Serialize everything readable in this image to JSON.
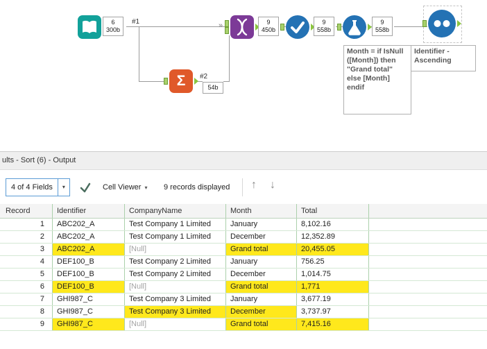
{
  "canvas": {
    "icons": {
      "sigma": "Σ",
      "conn_arrow": "»"
    },
    "labels": {
      "conn1": "#1",
      "conn2": "#2"
    },
    "counts": {
      "input": {
        "records": "6",
        "size": "300b"
      },
      "summarize": {
        "size": "54b"
      },
      "join": {
        "records": "9",
        "size": "450b"
      },
      "unique": {
        "records": "9",
        "size": "558b"
      },
      "formula": {
        "records": "9",
        "size": "558b"
      }
    },
    "notes": {
      "formula": "Month = if IsNull ([Month]) then \"Grand total\" else [Month] endif",
      "sort": "Identifier - Ascending"
    }
  },
  "results": {
    "title": "ults - Sort (6) - Output",
    "toolbar": {
      "fields": "4 of 4 Fields",
      "caret": "▾",
      "cell_viewer": "Cell Viewer",
      "records": "9 records displayed",
      "up": "↑",
      "down": "↓"
    },
    "grid": {
      "headers": {
        "record": "Record",
        "identifier": "Identifier",
        "company": "CompanyName",
        "month": "Month",
        "total": "Total"
      },
      "rows": [
        {
          "record": "1",
          "identifier": "ABC202_A",
          "company": "Test Company 1 Limited",
          "month": "January",
          "total": "8,102.16",
          "hl": {}
        },
        {
          "record": "2",
          "identifier": "ABC202_A",
          "company": "Test Company 1 Limited",
          "month": "December",
          "total": "12,352.89",
          "hl": {}
        },
        {
          "record": "3",
          "identifier": "ABC202_A",
          "company": "[Null]",
          "month": "Grand total",
          "total": "20,455.05",
          "hl": {
            "identifier": true,
            "month": true,
            "total": true
          }
        },
        {
          "record": "4",
          "identifier": "DEF100_B",
          "company": "Test Company 2 Limited",
          "month": "January",
          "total": "756.25",
          "hl": {}
        },
        {
          "record": "5",
          "identifier": "DEF100_B",
          "company": "Test Company 2 Limited",
          "month": "December",
          "total": "1,014.75",
          "hl": {}
        },
        {
          "record": "6",
          "identifier": "DEF100_B",
          "company": "[Null]",
          "month": "Grand total",
          "total": "1,771",
          "hl": {
            "identifier": true,
            "month": true,
            "total": true
          }
        },
        {
          "record": "7",
          "identifier": "GHI987_C",
          "company": "Test Company 3 Limited",
          "month": "January",
          "total": "3,677.19",
          "hl": {}
        },
        {
          "record": "8",
          "identifier": "GHI987_C",
          "company": "Test Company 3 Limited",
          "month": "December",
          "total": "3,737.97",
          "hl": {
            "company": true,
            "month": true
          }
        },
        {
          "record": "9",
          "identifier": "GHI987_C",
          "company": "[Null]",
          "month": "Grand total",
          "total": "7,415.16",
          "hl": {
            "identifier": true,
            "month": true,
            "total": true
          }
        }
      ]
    }
  }
}
